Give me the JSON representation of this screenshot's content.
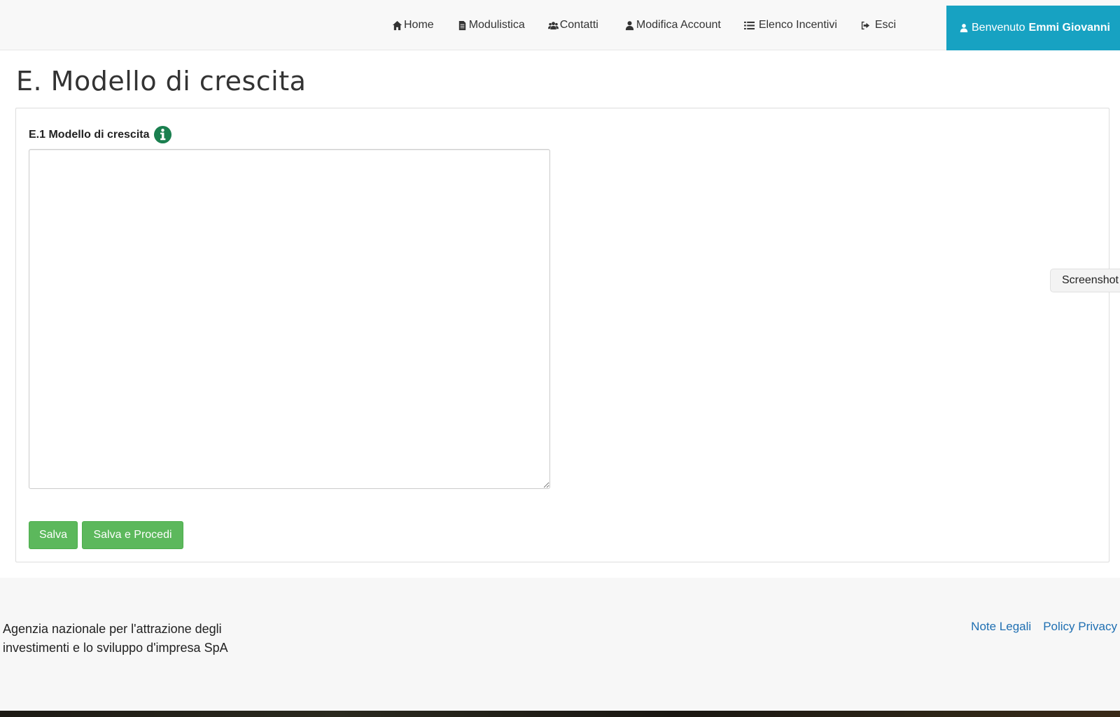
{
  "nav": {
    "items": [
      {
        "label": "Home",
        "icon": "home-icon"
      },
      {
        "label": "Modulistica",
        "icon": "document-icon"
      },
      {
        "label": "Contatti",
        "icon": "users-icon"
      },
      {
        "label": "Modifica Account",
        "icon": "user-icon"
      },
      {
        "label": "Elenco Incentivi",
        "icon": "list-icon"
      },
      {
        "label": "Esci",
        "icon": "logout-icon"
      }
    ],
    "welcome_prefix": "Benvenuto",
    "welcome_name": "Emmi Giovanni",
    "welcome_color": "#17a2c2"
  },
  "page": {
    "title": "E. Modello di crescita"
  },
  "form": {
    "field_label": "E.1 Modello di crescita",
    "field_value": "",
    "info_icon": "info-circle-icon",
    "info_color": "#1a7f4f",
    "save_label": "Salva",
    "save_proceed_label": "Salva e Procedi",
    "button_color": "#5cb85c"
  },
  "screenshot_tab": {
    "label": "Screenshot"
  },
  "footer": {
    "line1": "Agenzia nazionale per l'attrazione degli",
    "line2": "investimenti e lo sviluppo d'impresa SpA",
    "links": [
      "Note Legali",
      "Policy Privacy"
    ],
    "link_color": "#1f6fb2"
  }
}
